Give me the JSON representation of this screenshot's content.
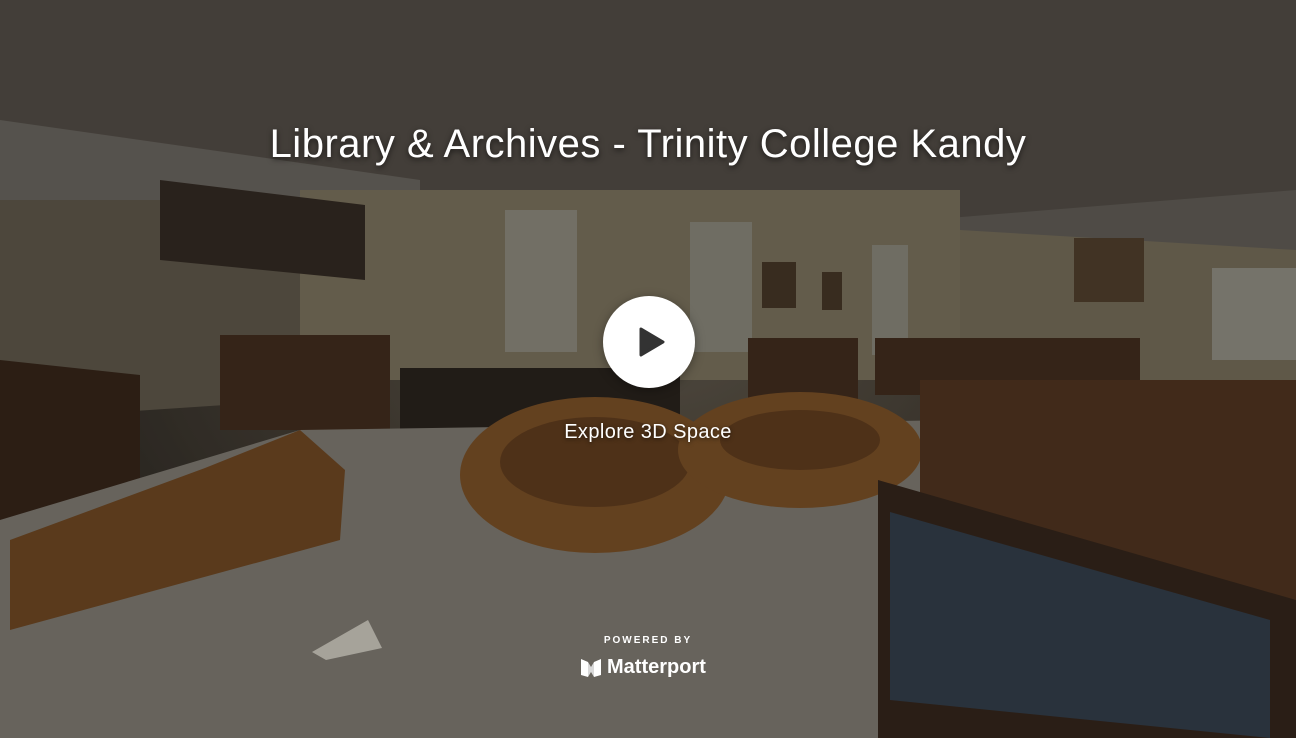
{
  "title": "Library & Archives - Trinity College Kandy",
  "play": {
    "icon": "play-icon",
    "label": "Explore 3D Space"
  },
  "footer": {
    "powered_by": "POWERED BY",
    "brand": "Matterport",
    "brand_icon": "matterport-logo-icon"
  },
  "colors": {
    "text": "#ffffff",
    "play_button": "#ffffff",
    "play_glyph": "#333333"
  }
}
